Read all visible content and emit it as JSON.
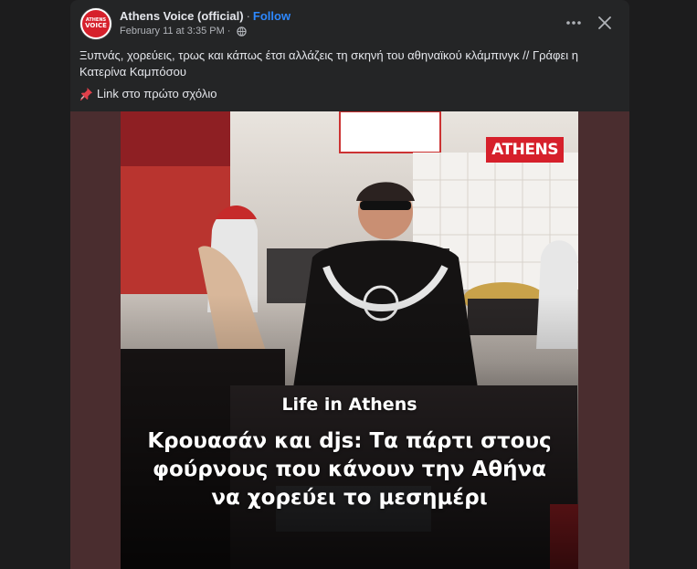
{
  "post": {
    "page_name": "Athens Voice (official)",
    "separator": "·",
    "follow_label": "Follow",
    "timestamp": "February 11 at 3:35 PM",
    "avatar": {
      "line1": "ATHENS",
      "line2": "VOICE"
    },
    "body_text": "Ξυπνάς, χορεύεις, τρως και κάπως έτσι αλλάζεις τη σκηνή του αθηναϊκού κλάμπινγκ // Γράφει η Κατερίνα Καμπόσου",
    "link_text": "Link στο πρώτο σχόλιο",
    "icons": {
      "more": "more-icon",
      "close": "close-icon",
      "audience": "globe-icon",
      "pin": "pushpin-icon"
    }
  },
  "media": {
    "logo_text": "ATHENS",
    "kicker": "Life in Athens",
    "headline_lines": [
      "Κρουασάν και djs: Τα πάρτι στους",
      "φούρνους που κάνουν την Αθήνα",
      "να χορεύει το μεσημέρι"
    ]
  },
  "colors": {
    "card": "#242526",
    "accent": "#2d88ff",
    "brand_red": "#d6202b",
    "text": "#e4e6eb",
    "muted": "#b0b3b8"
  }
}
